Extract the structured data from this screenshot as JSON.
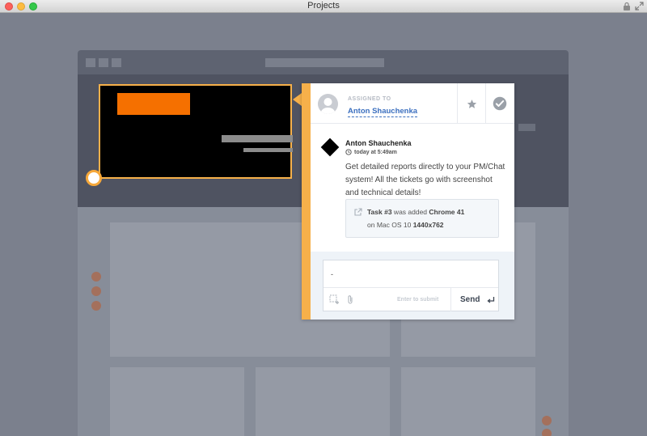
{
  "window": {
    "title": "Projects",
    "icons": [
      "lock-icon",
      "expand-icon"
    ]
  },
  "assignment": {
    "label": "ASSIGNED TO",
    "assignee": "Anton Shauchenka",
    "actions": [
      "star-icon",
      "check-circle-icon"
    ]
  },
  "comment": {
    "author": "Anton Shauchenka",
    "time": "today at 5:49am",
    "text": "Get detailed reports directly to your PM/Chat system! All the tickets go with screenshot and technical details!",
    "task": {
      "task_label": "Task #3",
      "added_text": " was added ",
      "browser": "Chrome 41",
      "os_prefix": "on Mac OS 10 ",
      "resolution": "1440x762"
    }
  },
  "reply": {
    "value": "-",
    "hint": "Enter to submit",
    "send_label": "Send"
  },
  "colors": {
    "accent": "#f6b04a",
    "link": "#3b6fbf",
    "highlight": "#f57000"
  }
}
